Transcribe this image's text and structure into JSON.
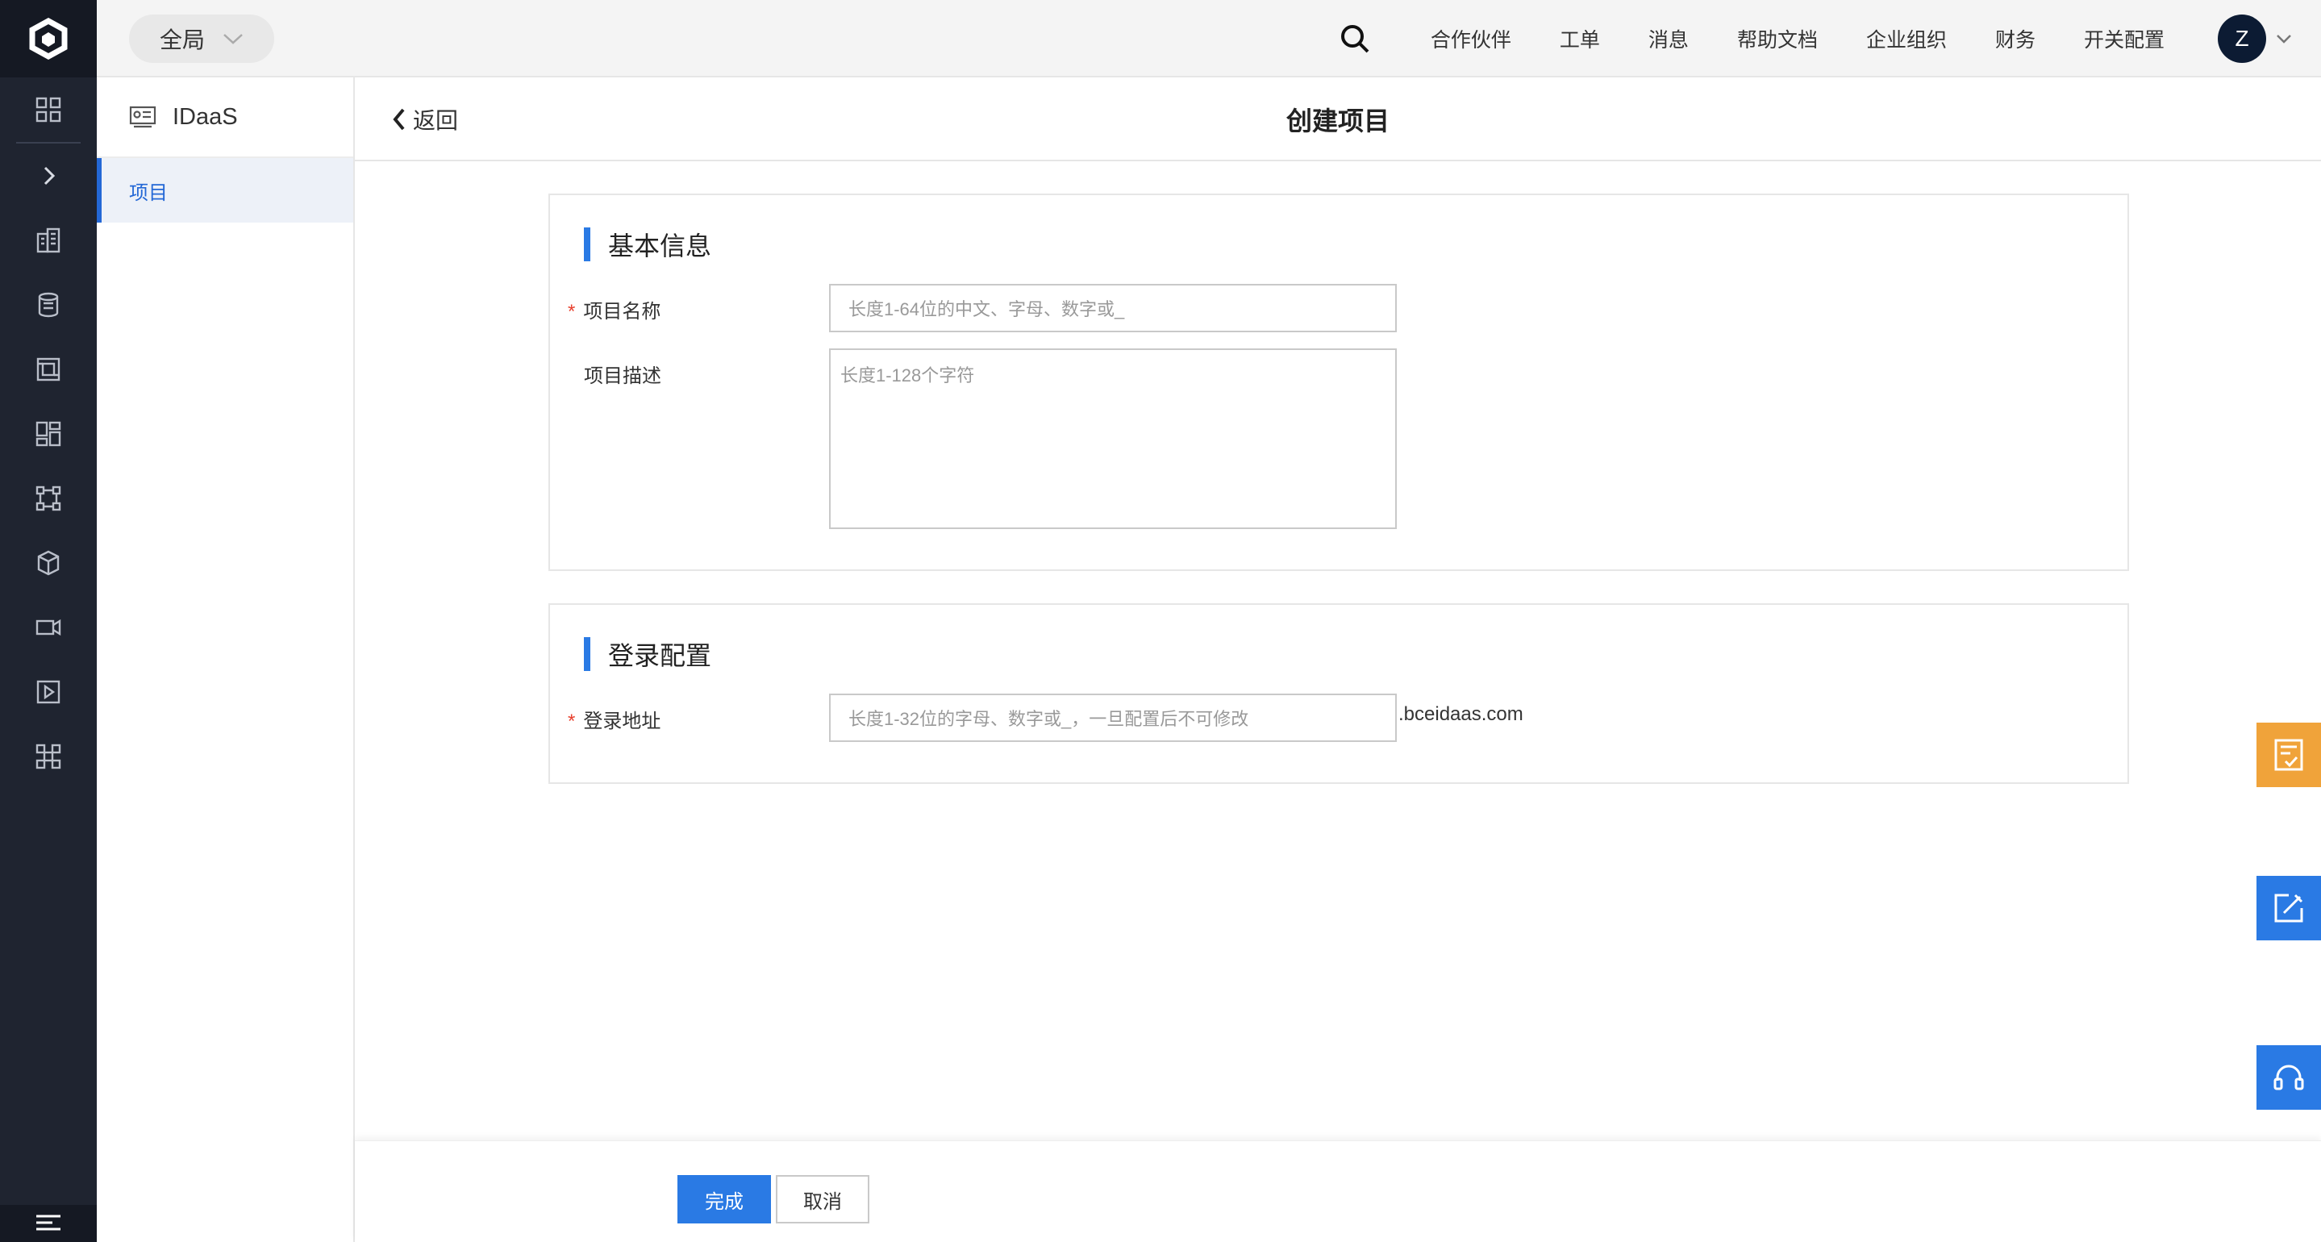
{
  "topbar": {
    "region_label": "全局",
    "nav": [
      "合作伙伴",
      "工单",
      "消息",
      "帮助文档",
      "企业组织",
      "财务",
      "开关配置"
    ],
    "avatar_letter": "Z"
  },
  "rail": {
    "icons": [
      "grid-icon",
      "expand-icon",
      "building-icon",
      "database-icon",
      "server-icon",
      "dashboard-icon",
      "network-icon",
      "package-icon",
      "video-icon",
      "play-icon",
      "cluster-icon"
    ]
  },
  "sidebar": {
    "product_name": "IDaaS",
    "items": [
      {
        "label": "项目"
      }
    ]
  },
  "header": {
    "back_label": "返回",
    "title": "创建项目"
  },
  "sections": {
    "basic": {
      "title": "基本信息",
      "name_label": "项目名称",
      "name_placeholder": "长度1-64位的中文、字母、数字或_",
      "desc_label": "项目描述",
      "desc_placeholder": "长度1-128个字符"
    },
    "login": {
      "title": "登录配置",
      "address_label": "登录地址",
      "address_placeholder": "长度1-32位的字母、数字或_，一旦配置后不可修改",
      "address_suffix": ".bceidaas.com"
    }
  },
  "footer": {
    "submit_label": "完成",
    "cancel_label": "取消"
  },
  "colors": {
    "accent": "#2a7ae4",
    "rail": "#1f2430",
    "required": "#e8412f",
    "float_orange": "#f0a33a"
  }
}
